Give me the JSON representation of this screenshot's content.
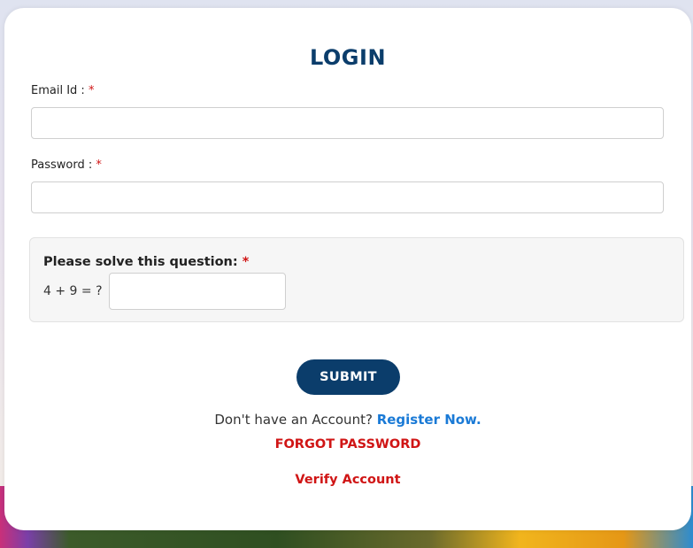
{
  "form": {
    "title": "LOGIN",
    "email_label": "Email Id :",
    "email_value": "",
    "password_label": "Password :",
    "password_value": "",
    "required_marker": "*"
  },
  "captcha": {
    "question": "Please solve this question:",
    "required_marker": "*",
    "expression": "4 + 9 = ?",
    "answer_value": ""
  },
  "actions": {
    "submit_label": "SUBMIT",
    "no_account_text": "Don't have an Account?",
    "register_label": "Register Now.",
    "forgot_label": "FORGOT PASSWORD",
    "verify_label": "Verify Account"
  },
  "colors": {
    "primary": "#0b3d6b",
    "link_blue": "#1a7ad6",
    "alert_red": "#d01515"
  }
}
